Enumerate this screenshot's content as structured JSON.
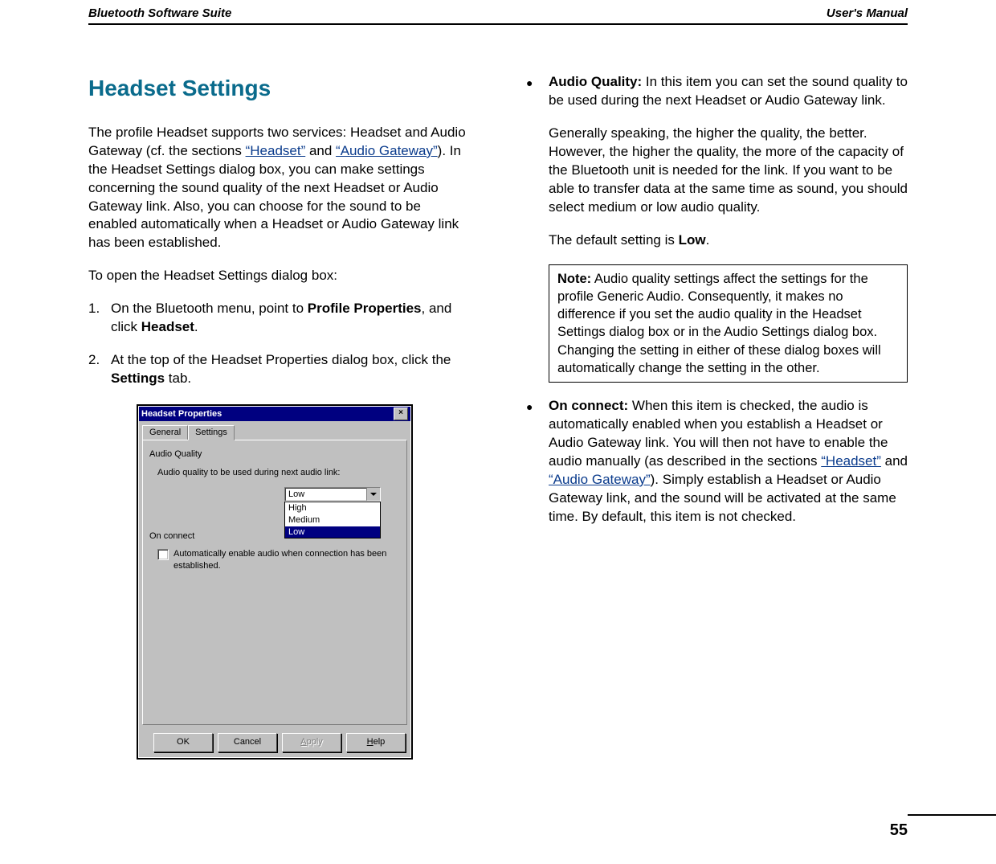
{
  "header": {
    "left": "Bluetooth Software Suite",
    "right": "User's Manual"
  },
  "section_title": "Headset Settings",
  "intro": {
    "pre": "The profile Headset supports two services: Headset and Audio Gateway (cf. the sections ",
    "link1": "“Headset”",
    "mid": " and ",
    "link2": "“Audio Gateway”",
    "post": "). In the Headset Settings dialog box, you can make settings concerning the sound quality of the next Headset or Audio Gateway link. Also, you can choose for the sound to be enabled automatically when a Headset or Audio Gateway link has been established."
  },
  "open_text": "To open the Headset Settings dialog box:",
  "steps": [
    {
      "num": "1.",
      "pre": "On the Bluetooth menu, point to ",
      "b1": "Profile Properties",
      "mid": ", and click ",
      "b2": "Headset",
      "post": "."
    },
    {
      "num": "2.",
      "pre": "At the top of the Headset Properties dialog box, click the ",
      "b1": "Settings",
      "mid": " tab.",
      "b2": "",
      "post": ""
    }
  ],
  "dialog": {
    "title": "Headset Properties",
    "tabs": [
      "General",
      "Settings"
    ],
    "active_tab": "Settings",
    "group1_label": "Audio Quality",
    "field1_label": "Audio quality to be used during next audio link:",
    "combo_value": "Low",
    "combo_options": [
      "High",
      "Medium",
      "Low"
    ],
    "combo_selected": "Low",
    "group2_label": "On connect",
    "checkbox_label": "Automatically enable audio when connection has been established.",
    "buttons": {
      "ok": "OK",
      "cancel": "Cancel",
      "apply": "Apply",
      "help": "Help"
    }
  },
  "right": {
    "audio_quality": {
      "label": "Audio Quality:",
      "text1": " In this item you can set the sound quality to be used during the next Headset or Audio Gateway link.",
      "text2": "Generally speaking, the higher the quality, the better. However, the higher the quality, the more of the capacity of the Bluetooth unit is needed for the link. If you want to be able to transfer data at the same time as sound, you should select medium or low audio quality.",
      "default_pre": "The default setting is ",
      "default_bold": "Low",
      "default_post": "."
    },
    "note": {
      "label": "Note:",
      "text": " Audio quality settings affect the settings for the profile Generic Audio. Consequently, it makes no difference if you set the audio quality in the Headset Settings dialog box or in the Audio Settings dialog box. Changing the setting in either of these dialog boxes will automatically change the setting in the other."
    },
    "on_connect": {
      "label": "On connect:",
      "pre": " When this item is checked, the audio is automatically enabled when you establish a Headset or Audio Gateway link. You will then not have to enable the audio manually (as described in the sections ",
      "link1": "“Headset”",
      "mid": " and ",
      "link2": "“Audio Gateway”",
      "post": "). Simply establish a Headset or Audio Gateway link, and the sound will be activated at the same time. By default, this item is not checked."
    }
  },
  "page_number": "55"
}
